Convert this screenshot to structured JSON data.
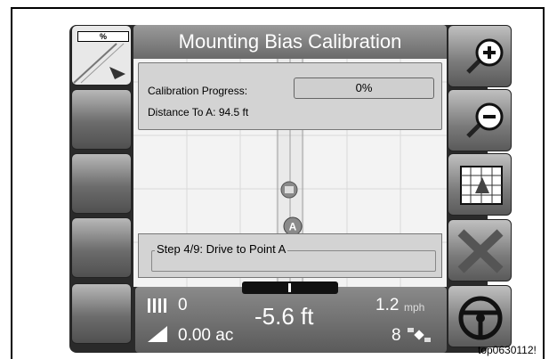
{
  "title": "Mounting Bias Calibration",
  "calibration": {
    "progress_label": "Calibration Progress:",
    "progress_value": "0%",
    "distance_label": "Distance To A: 94.5 ft"
  },
  "step_text": "Step 4/9: Drive to Point A",
  "map_markers": {
    "point_a": "A"
  },
  "left_panel": {
    "battery_label": "%"
  },
  "status": {
    "swath_count": "0",
    "offset": "-5.6 ft",
    "area": "0.00 ac",
    "speed": "1.2",
    "speed_unit": "mph",
    "satellites": "8"
  },
  "caption": "top0630112!",
  "colors": {
    "map_bg": "#f3f3f3",
    "panel_bg": "#d3d3d3",
    "button_dark": "#505050"
  },
  "icons": [
    "zoom-in-icon",
    "zoom-out-icon",
    "grid-view-icon",
    "cancel-x-icon",
    "steering-wheel-icon",
    "satellite-icon",
    "swath-icon",
    "area-icon"
  ]
}
